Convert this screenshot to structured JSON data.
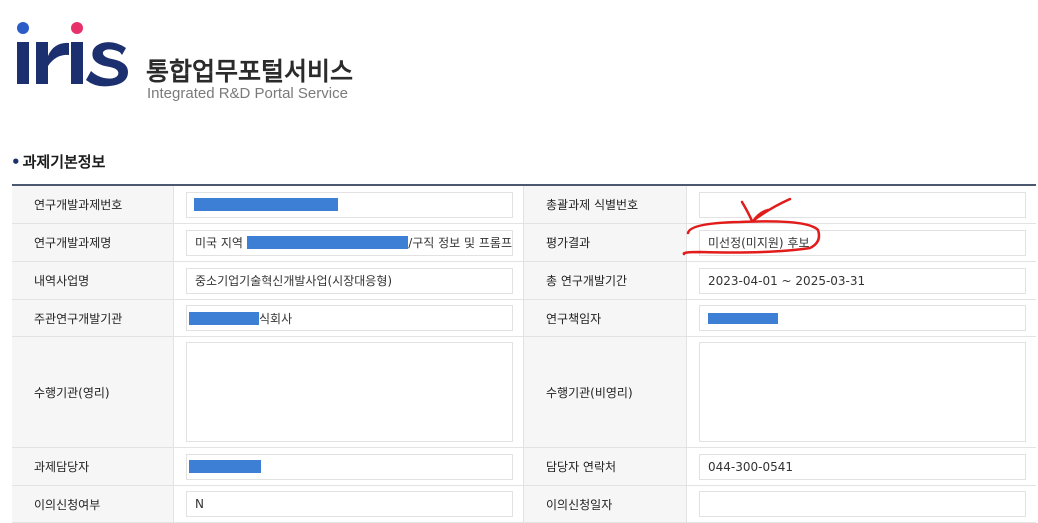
{
  "brand": {
    "logo_word": "iris",
    "title_ko": "통합업무포털서비스",
    "title_en": "Integrated R&D Portal Service",
    "colors": {
      "navy": "#1c2f6e",
      "dot_blue": "#2b5cc8",
      "dot_pink": "#e8316b"
    }
  },
  "section": {
    "title": "과제기본정보"
  },
  "rows": [
    {
      "left_label": "연구개발과제번호",
      "left_value": "",
      "right_label": "총괄과제 식별번호",
      "right_value": ""
    },
    {
      "left_label": "연구개발과제명",
      "left_value_prefix": "미국 지역",
      "left_value_suffix": "/구직 정보 및 프롬프",
      "right_label": "평가결과",
      "right_value": "미선정(미지원) 후보"
    },
    {
      "left_label": "내역사업명",
      "left_value": "중소기업기술혁신개발사업(시장대응형)",
      "right_label": "총 연구개발기간",
      "right_value": "2023-04-01 ~ 2025-03-31"
    },
    {
      "left_label": "주관연구개발기관",
      "left_value_suffix": "식회사",
      "right_label": "연구책임자",
      "right_value": ""
    },
    {
      "left_label": "수행기관(영리)",
      "left_value": "",
      "right_label": "수행기관(비영리)",
      "right_value": ""
    },
    {
      "left_label": "과제담당자",
      "left_value": "",
      "right_label": "담당자 연락처",
      "right_value": "044-300-0541"
    },
    {
      "left_label": "이의신청여부",
      "left_value": "N",
      "right_label": "이의신청일자",
      "right_value": ""
    }
  ],
  "redaction_color": "#3d7fd5",
  "annotation_color": "#e21b1b"
}
